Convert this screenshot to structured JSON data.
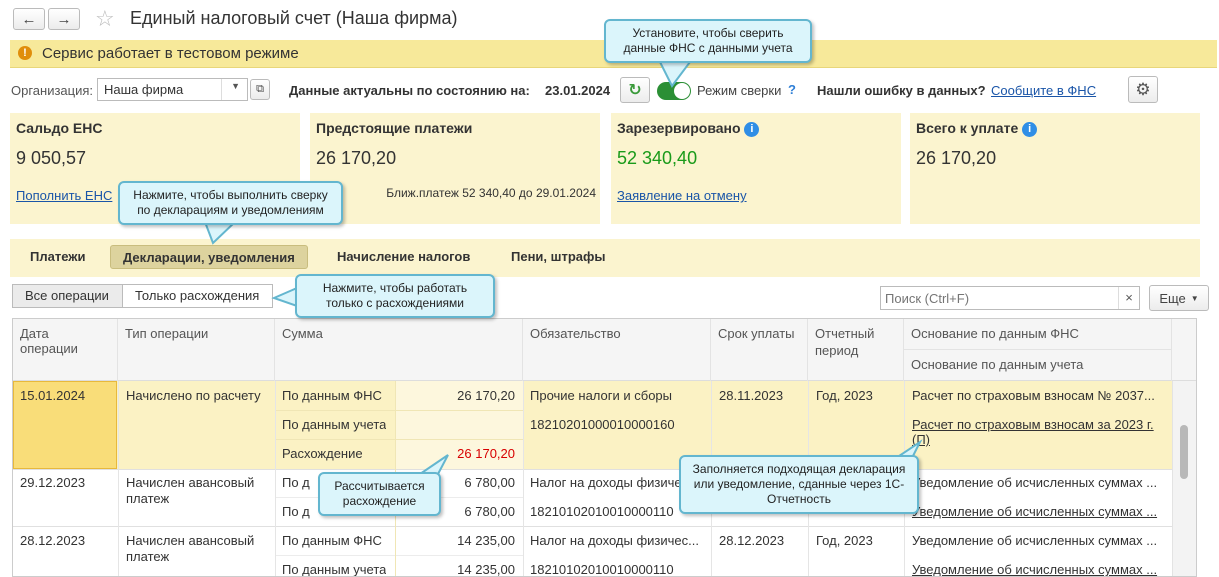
{
  "window": {
    "title": "Единый налоговый счет (Наша фирма)"
  },
  "banner": {
    "text": "Сервис работает в тестовом режиме"
  },
  "toolbar": {
    "org_label": "Организация:",
    "org_value": "Наша фирма",
    "data_actual_label": "Данные актуальны по состоянию на:",
    "data_actual_date": "23.01.2024",
    "reconcile_label": "Режим сверки",
    "help_mark": "?",
    "error_text": "Нашли ошибку в данных?",
    "error_link": "Сообщите в ФНС"
  },
  "cards": {
    "saldo": {
      "title": "Сальдо ЕНС",
      "value": "9 050,57",
      "link": "Пополнить ЕНС"
    },
    "upcoming": {
      "title": "Предстоящие платежи",
      "value": "26 170,20",
      "note": "Ближ.платеж 52 340,40 до 29.01.2024"
    },
    "reserved": {
      "title": "Зарезервировано",
      "value": "52 340,40",
      "link": "Заявление на отмену"
    },
    "total": {
      "title": "Всего к уплате",
      "value": "26 170,20"
    }
  },
  "tabs": [
    {
      "label": "Платежи"
    },
    {
      "label": "Декларации, уведомления"
    },
    {
      "label": "Начисление налогов"
    },
    {
      "label": "Пени, штрафы"
    }
  ],
  "filters": {
    "all": "Все операции",
    "diff_only": "Только расхождения",
    "search_placeholder": "Поиск (Ctrl+F)",
    "more": "Еще"
  },
  "table": {
    "headers": {
      "date": "Дата операции",
      "type": "Тип операции",
      "sum": "Сумма",
      "obligation": "Обязательство",
      "due": "Срок уплаты",
      "period": "Отчетный период",
      "basis_fns": "Основание по данным ФНС",
      "basis_acc": "Основание по данным учета"
    },
    "rows": [
      {
        "date": "15.01.2024",
        "type": "Начислено по расчету",
        "fns_label": "По данным ФНС",
        "fns_value": "26 170,20",
        "acc_label": "По данным учета",
        "diff_label": "Расхождение",
        "diff_value": "26 170,20",
        "obligation": "Прочие налоги и сборы",
        "kbk": "18210201000010000160",
        "due": "28.11.2023",
        "period": "Год, 2023",
        "basis_fns": "Расчет по страховым взносам № 2037...",
        "basis_acc": "Расчет по страховым взносам за 2023 г.",
        "basis_acc2": "(П)"
      },
      {
        "date": "29.12.2023",
        "type": "Начислен авансовый",
        "type2": "платеж",
        "fns_label": "По д",
        "fns_value": "6 780,00",
        "acc_label": "По д",
        "acc_value": "6 780,00",
        "obligation": "Налог на доходы физичес...",
        "kbk": "18210102010010000110",
        "basis_fns": "Уведомление об исчисленных суммах ...",
        "basis_acc": "Уведомление об исчисленных суммах ..."
      },
      {
        "date": "28.12.2023",
        "type": "Начислен авансовый",
        "type2": "платеж",
        "fns_label": "По данным ФНС",
        "fns_value": "14 235,00",
        "acc_label": "По данным учета",
        "acc_value": "14 235,00",
        "obligation": "Налог на доходы физичес...",
        "kbk": "18210102010010000110",
        "due": "28.12.2023",
        "period": "Год, 2023",
        "basis_fns": "Уведомление об исчисленных суммах ...",
        "basis_acc": "Уведомление об исчисленных суммах ..."
      }
    ]
  },
  "callouts": {
    "reconcile": "Установите, чтобы сверить данные ФНС с данными учета",
    "declarations": "Нажмите, чтобы выполнить сверку по декларациям и уведомлениям",
    "discrepancies": "Нажмите, чтобы работать только с расхождениями",
    "calc": "Рассчитывается расхождение",
    "fill": "Заполняется подходящая декларация или уведомление, сданные через 1С-Отчетность"
  },
  "colors": {
    "banner": "#f7e99a",
    "card": "#fbf4cf",
    "highlight": "#fbf2c4",
    "green": "#1a9a1a",
    "red": "#d80000",
    "link": "#1a55a8",
    "callout_bg": "#dbf5fb",
    "callout_border": "#63b6cf"
  }
}
